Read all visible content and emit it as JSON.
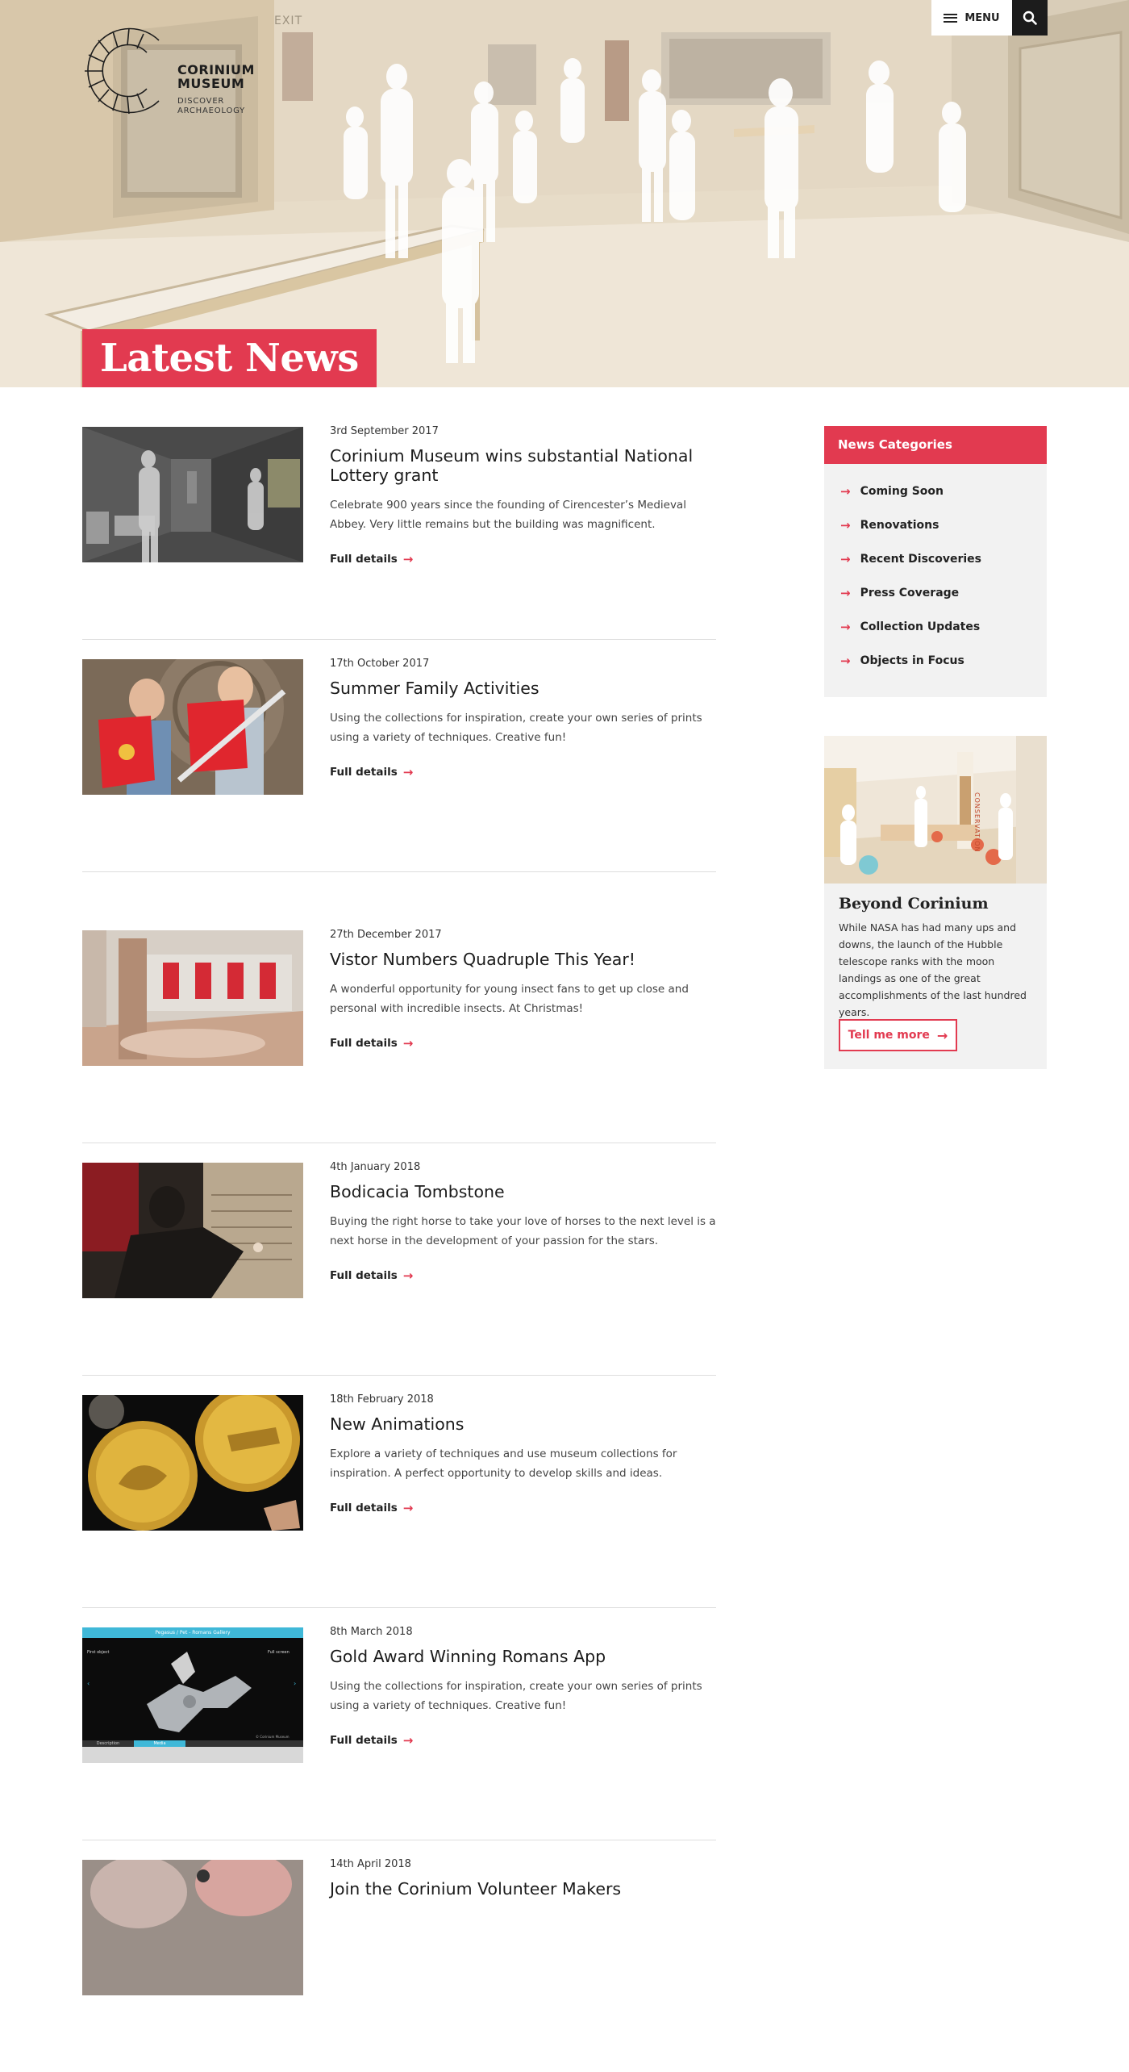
{
  "header": {
    "logo": {
      "name": "CORINIUM MUSEUM",
      "tagline": "DISCOVER ARCHAEOLOGY"
    },
    "menu_label": "MENU",
    "hero_sign": "EXIT",
    "page_title": "Latest News"
  },
  "news": [
    {
      "date": "3rd September 2017",
      "title": "Corinium Museum wins substantial National Lottery grant",
      "text": "Celebrate 900 years since the founding of Cirencester’s Medieval Abbey. Very little remains but the building was magnificent.",
      "link": "Full details"
    },
    {
      "date": "17th October 2017",
      "title": "Summer Family Activities",
      "text": "Using the collections for inspiration, create your own series of prints using a variety of techniques. Creative fun!",
      "link": "Full details"
    },
    {
      "date": "27th December 2017",
      "title": "Vistor Numbers Quadruple This Year!",
      "text": "A wonderful opportunity for young insect fans to get up close and personal with incredible insects. At Christmas!",
      "link": "Full details"
    },
    {
      "date": "4th January 2018",
      "title": "Bodicacia Tombstone",
      "text": "Buying the right horse to take your love of horses to the next level is a next horse in the development of your passion for the stars.",
      "link": "Full details"
    },
    {
      "date": "18th February 2018",
      "title": "New Animations",
      "text": "Explore a variety of techniques and use museum collections for inspiration. A perfect opportunity to develop skills and ideas.",
      "link": "Full details"
    },
    {
      "date": "8th March 2018",
      "title": "Gold Award Winning Romans App",
      "text": "Using the collections for inspiration, create your own series of prints using a variety of techniques. Creative fun!",
      "link": "Full details"
    },
    {
      "date": "14th April 2018",
      "title": "Join the Corinium Volunteer Makers",
      "text": "",
      "link": ""
    }
  ],
  "sidebar": {
    "categories_title": "News Categories",
    "categories": [
      "Coming Soon",
      "Renovations",
      "Recent Discoveries",
      "Press Coverage",
      "Collection Updates",
      "Objects in Focus"
    ],
    "promo": {
      "image_sign": "CONSERVATION",
      "title": "Beyond Corinium",
      "text": "While NASA has had many ups and downs, the launch of the Hubble telescope ranks with the moon landings as one of the great accomplishments of the last hundred years.",
      "button": "Tell me more"
    }
  },
  "app_screen": {
    "title": "Pegasus / Pet - Romans Gallery",
    "first_object": "First object",
    "full_screen": "Full screen",
    "tab_description": "Description",
    "tab_media": "Media",
    "credit": "© Corinium Museum"
  },
  "colors": {
    "accent": "#e23a50",
    "dark": "#1c1c1c",
    "panel": "#f2f2f2"
  }
}
